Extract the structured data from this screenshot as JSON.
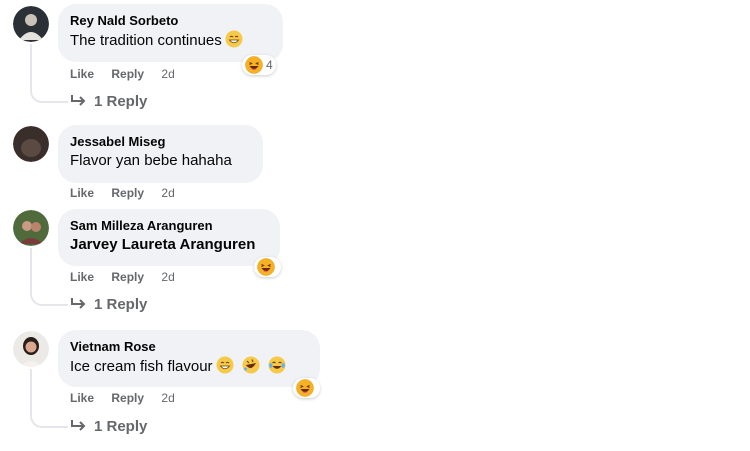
{
  "comments": [
    {
      "author": "Rey Nald Sorbeto",
      "text": "The tradition continues",
      "inline_emoji": [
        "grinning-squint-face"
      ],
      "actions": {
        "like": "Like",
        "reply": "Reply",
        "time": "2d"
      },
      "reaction": {
        "emoji": "laughing-face",
        "count": "4"
      },
      "replies": "1 Reply"
    },
    {
      "author": "Jessabel Miseg",
      "text": "Flavor yan bebe hahaha",
      "actions": {
        "like": "Like",
        "reply": "Reply",
        "time": "2d"
      }
    },
    {
      "author": "Sam Milleza Aranguren",
      "text": "Jarvey Laureta Aranguren",
      "actions": {
        "like": "Like",
        "reply": "Reply",
        "time": "2d"
      },
      "reaction": {
        "emoji": "laughing-face",
        "count": ""
      },
      "replies": "1 Reply"
    },
    {
      "author": "Vietnam Rose",
      "text": "Ice cream fish flavour",
      "inline_emoji": [
        "grinning-face",
        "rolling-laughing-face",
        "tears-of-joy-face"
      ],
      "actions": {
        "like": "Like",
        "reply": "Reply",
        "time": "2d"
      },
      "reaction": {
        "emoji": "laughing-face",
        "count": ""
      },
      "replies": "1 Reply"
    }
  ],
  "colors": {
    "bubble": "#f0f2f5",
    "meta": "#65676b",
    "text": "#050505",
    "emoji": "#f7b125"
  }
}
